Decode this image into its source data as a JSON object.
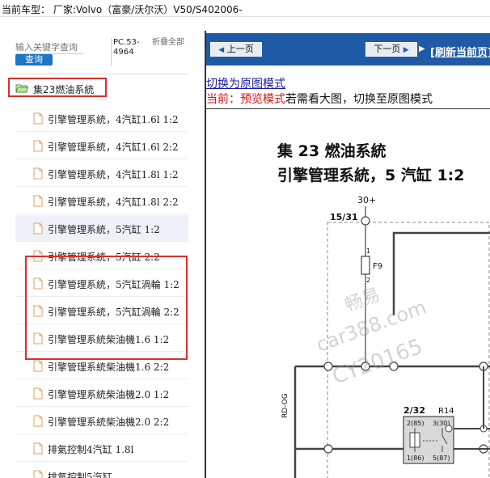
{
  "header": {
    "title": "当前车型： 厂家:Volvo（富豪/沃尔沃）V50/S402006-"
  },
  "sidebar": {
    "search_placeholder": "输入关键字查询",
    "search_button": "查询",
    "pc_code": "PC.53-4964",
    "collapse_all": "折叠全部",
    "folder": "集23燃油系統",
    "items": [
      {
        "label": "引擎管理系統，4汽缸1.6l 1:2"
      },
      {
        "label": "引擎管理系統，4汽缸1.6l 2:2"
      },
      {
        "label": "引擎管理系統，4汽缸1.8l 1:2"
      },
      {
        "label": "引擎管理系統，4汽缸1.8l 2:2"
      },
      {
        "label": "引擎管理系統，5汽缸 1:2"
      },
      {
        "label": "引擎管理系統，5汽缸 2:2"
      },
      {
        "label": "引擎管理系統，5汽缸渦輪 1:2"
      },
      {
        "label": "引擎管理系統，5汽缸渦輪 2:2"
      },
      {
        "label": "引擎管理系統柴油機1.6 1:2"
      },
      {
        "label": "引擎管理系統柴油機1.6 2:2"
      },
      {
        "label": "引擎管理系統柴油機2.0 1:2"
      },
      {
        "label": "引擎管理系統柴油機2.0 2:2"
      },
      {
        "label": "排氣控制4汽缸 1.8l"
      },
      {
        "label": "排氣控制5汽缸"
      }
    ]
  },
  "viewer": {
    "prev_button": "上一页",
    "next_button": "下一页",
    "refresh_link": "[刷新当前页]",
    "switch_link": "切换为原图模式",
    "mode_prefix": "当前：预览模式",
    "mode_suffix": "若需看大图，切换至原图模式",
    "diagram": {
      "title1": "集 23 燃油系統",
      "title2": "引擎管理系統，5 汽缸 1:2",
      "label_30": "30+",
      "label_15_31": "15/31",
      "fuse_label": "F9",
      "fuse_pin1": "1",
      "fuse_pin2": "2",
      "wire_label": "RD-OG",
      "relay_ref": "2/32",
      "relay_name": "R14",
      "pin_2_85": "2(85)",
      "pin_3_30": "3(30)",
      "pin_1_86": "1(86)",
      "pin_5_87": "5(87)",
      "watermark1": "畅易",
      "watermark2": "car388.com",
      "watermark3": "CY20165"
    }
  },
  "colors": {
    "navbar": "#1f5aa6",
    "highlight": "#d9302c",
    "link": "#1a1aa8",
    "search_button": "#1d74c8"
  }
}
